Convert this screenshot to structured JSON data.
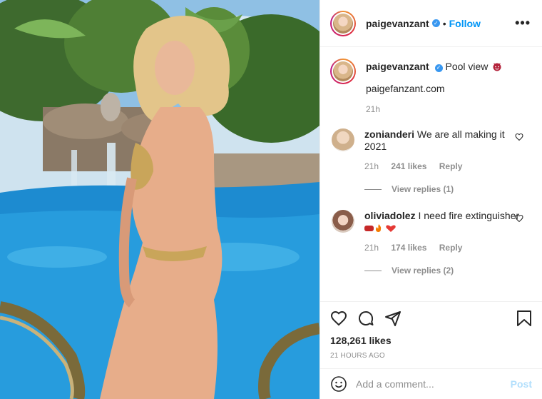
{
  "post": {
    "username": "paigevanzant",
    "follow_label": "Follow",
    "more_icon": "more-horizontal-icon",
    "caption_text": "Pool view",
    "caption_emoji": "devil-emoji",
    "caption_link": "paigefanzant.com",
    "caption_time": "21h"
  },
  "comments": [
    {
      "username": "zonianderi",
      "text": "We are all making it 2021",
      "time": "21h",
      "likes": "241 likes",
      "reply_label": "Reply",
      "view_replies": "View replies (1)"
    },
    {
      "username": "oliviadolez",
      "text": "I need fire extinguisher",
      "time": "21h",
      "likes": "174 likes",
      "reply_label": "Reply",
      "view_replies": "View replies (2)"
    }
  ],
  "actions": {
    "likes_count": "128,261 likes",
    "time_ago": "21 HOURS AGO"
  },
  "comment_box": {
    "placeholder": "Add a comment...",
    "post_label": "Post"
  },
  "colors": {
    "link_blue": "#0095f6",
    "verified_blue": "#3897f0",
    "post_disabled": "#b2dffc",
    "muted": "#8e8e8e"
  }
}
